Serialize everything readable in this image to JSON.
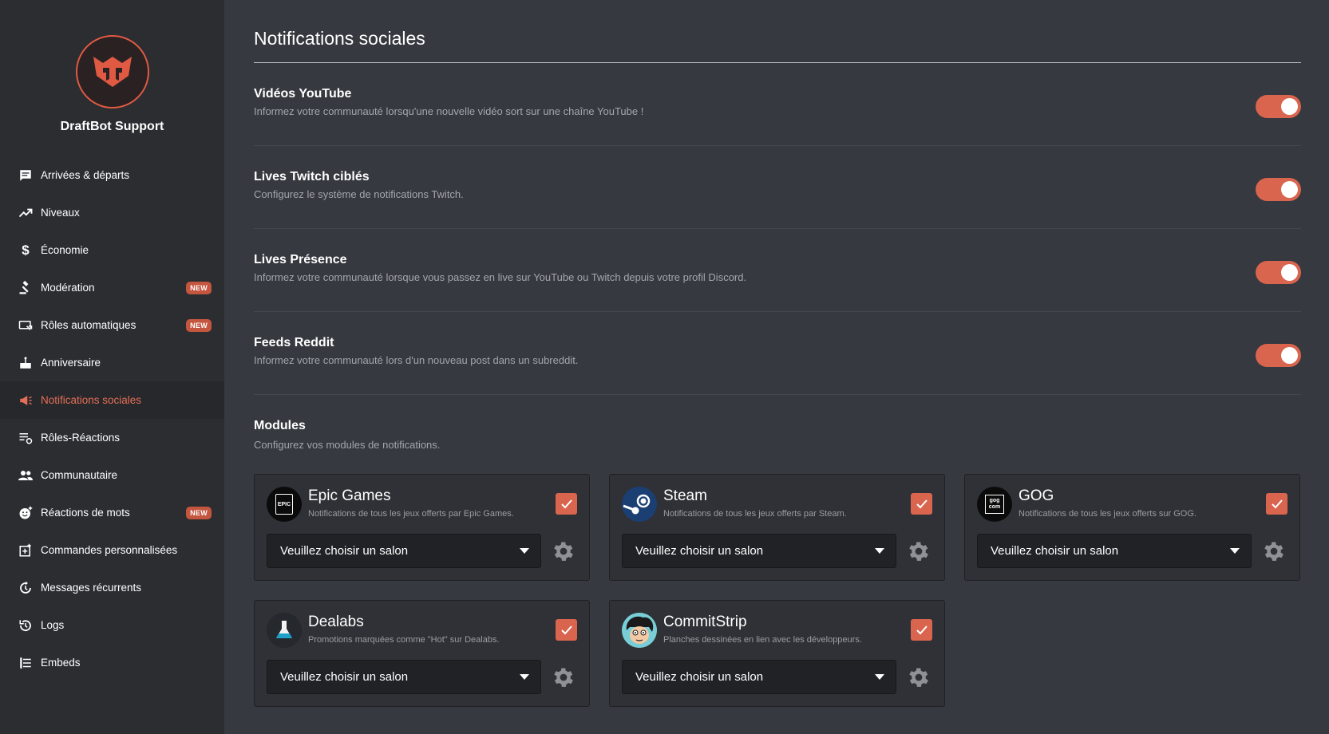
{
  "server": {
    "name": "DraftBot Support"
  },
  "sidebar": {
    "items": [
      {
        "label": "Arrivées & départs",
        "icon": "chat-bubble-icon",
        "badge": ""
      },
      {
        "label": "Niveaux",
        "icon": "trending-up-icon",
        "badge": ""
      },
      {
        "label": "Économie",
        "icon": "dollar-icon",
        "badge": ""
      },
      {
        "label": "Modération",
        "icon": "gavel-icon",
        "badge": "NEW"
      },
      {
        "label": "Rôles automatiques",
        "icon": "role-card-icon",
        "badge": "NEW"
      },
      {
        "label": "Anniversaire",
        "icon": "cake-icon",
        "badge": ""
      },
      {
        "label": "Notifications sociales",
        "icon": "megaphone-icon",
        "badge": "",
        "active": true
      },
      {
        "label": "Rôles-Réactions",
        "icon": "list-reaction-icon",
        "badge": ""
      },
      {
        "label": "Communautaire",
        "icon": "people-icon",
        "badge": ""
      },
      {
        "label": "Réactions de mots",
        "icon": "emoji-add-icon",
        "badge": "NEW"
      },
      {
        "label": "Commandes personnalisées",
        "icon": "custom-command-icon",
        "badge": ""
      },
      {
        "label": "Messages récurrents",
        "icon": "recurring-icon",
        "badge": ""
      },
      {
        "label": "Logs",
        "icon": "history-icon",
        "badge": ""
      },
      {
        "label": "Embeds",
        "icon": "embed-icon",
        "badge": ""
      }
    ]
  },
  "page": {
    "title": "Notifications sociales"
  },
  "features": [
    {
      "title": "Vidéos YouTube",
      "desc": "Informez votre communauté lorsqu'une nouvelle vidéo sort sur une chaîne YouTube !",
      "enabled": true
    },
    {
      "title": "Lives Twitch ciblés",
      "desc": "Configurez le système de notifications Twitch.",
      "enabled": true
    },
    {
      "title": "Lives Présence",
      "desc": "Informez votre communauté lorsque vous passez en live sur YouTube ou Twitch depuis votre profil Discord.",
      "enabled": true
    },
    {
      "title": "Feeds Reddit",
      "desc": "Informez votre communauté lors d'un nouveau post dans un subreddit.",
      "enabled": true
    }
  ],
  "modules": {
    "title": "Modules",
    "desc": "Configurez vos modules de notifications.",
    "cards": [
      {
        "name": "Epic Games",
        "desc": "Notifications de tous les jeux offerts par Epic Games.",
        "select": "Veuillez choisir un salon",
        "checked": true,
        "logo_text": "EPIC"
      },
      {
        "name": "Steam",
        "desc": "Notifications de tous les jeux offerts par Steam.",
        "select": "Veuillez choisir un salon",
        "checked": true
      },
      {
        "name": "GOG",
        "desc": "Notifications de tous les jeux offerts sur GOG.",
        "select": "Veuillez choisir un salon",
        "checked": true,
        "logo_text": "gog com"
      },
      {
        "name": "Dealabs",
        "desc": "Promotions marquées comme \"Hot\" sur Dealabs.",
        "select": "Veuillez choisir un salon",
        "checked": true
      },
      {
        "name": "CommitStrip",
        "desc": "Planches dessinées en lien avec les développeurs.",
        "select": "Veuillez choisir un salon",
        "checked": true
      }
    ]
  },
  "colors": {
    "accent": "#d9654f",
    "sidebar_bg": "#2b2d31",
    "main_bg": "#36393f"
  }
}
